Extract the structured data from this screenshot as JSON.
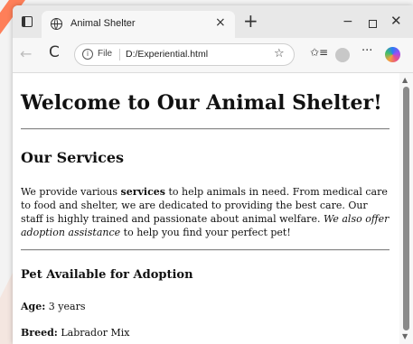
{
  "browser": {
    "tab_title": "Animal Shelter",
    "tab_close": "×",
    "new_tab": "+",
    "minimize": "−",
    "close": "✕",
    "back": "←",
    "reload": "C",
    "info": "i",
    "file_label": "File",
    "url": "D:/Experiential.html",
    "star": "☆",
    "favorites": "✩≡",
    "more": "···"
  },
  "page": {
    "heading": "Welcome to Our Animal Shelter!",
    "services_heading": "Our Services",
    "services_text": {
      "part1": "We provide various ",
      "bold": "services",
      "part2": " to help animals in need. From medical care to food and shelter, we are dedicated to providing the best care. Our staff is highly trained and passionate about animal welfare. ",
      "italic": "We also offer adoption assistance",
      "part3": " to help you find your perfect pet!"
    },
    "adoption_heading": "Pet Available for Adoption",
    "age_label": "Age:",
    "age_value": " 3 years",
    "breed_label": "Breed:",
    "breed_value": " Labrador Mix"
  },
  "colors": {
    "stripe": "#ff6a3d",
    "scroll_thumb": "#8a8a8a"
  },
  "icons": [
    "window-icon",
    "globe-icon",
    "info-icon",
    "star-icon",
    "favorites-icon",
    "profile-icon",
    "more-icon",
    "copilot-icon"
  ]
}
